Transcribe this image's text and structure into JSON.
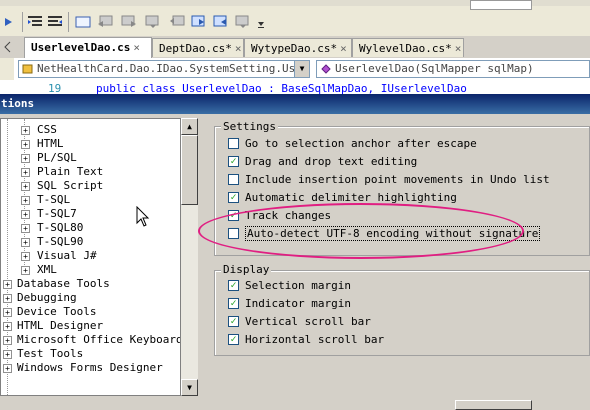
{
  "toolbar": {
    "icons": [
      "step-icon",
      "indent-icon",
      "outdent-icon",
      "comment-icon",
      "bookmark-prev-icon",
      "bookmark-next-icon",
      "bookmark-icon",
      "bookmark-toggle-icon",
      "bookmark-clear-icon",
      "overflow-icon"
    ]
  },
  "tabs": [
    {
      "label": "UserlevelDao.cs",
      "active": true,
      "close": "×"
    },
    {
      "label": "DeptDao.cs*",
      "active": false,
      "close": "×"
    },
    {
      "label": "WytypeDao.cs*",
      "active": false,
      "close": "×"
    },
    {
      "label": "WylevelDao.cs*",
      "active": false,
      "close": "×"
    }
  ],
  "navbar": {
    "type_combo": "NetHealthCard.Dao.IDao.SystemSetting.Userl",
    "member_combo": "UserlevelDao(SqlMapper sqlMap)"
  },
  "code": {
    "line_number": "19",
    "text": "public class UserlevelDao : BaseSqlMapDao, IUserlevelDao"
  },
  "dialog": {
    "title": "tions"
  },
  "tree": {
    "items": [
      {
        "label": "CSS",
        "level": 2,
        "expander": "+"
      },
      {
        "label": "HTML",
        "level": 2,
        "expander": "+"
      },
      {
        "label": "PL/SQL",
        "level": 2,
        "expander": "+"
      },
      {
        "label": "Plain Text",
        "level": 2,
        "expander": "+"
      },
      {
        "label": "SQL Script",
        "level": 2,
        "expander": "+"
      },
      {
        "label": "T-SQL",
        "level": 2,
        "expander": "+"
      },
      {
        "label": "T-SQL7",
        "level": 2,
        "expander": "+"
      },
      {
        "label": "T-SQL80",
        "level": 2,
        "expander": "+"
      },
      {
        "label": "T-SQL90",
        "level": 2,
        "expander": "+"
      },
      {
        "label": "Visual J#",
        "level": 2,
        "expander": "+"
      },
      {
        "label": "XML",
        "level": 2,
        "expander": "+"
      },
      {
        "label": "Database Tools",
        "level": 1,
        "expander": "+"
      },
      {
        "label": "Debugging",
        "level": 1,
        "expander": "+"
      },
      {
        "label": "Device Tools",
        "level": 1,
        "expander": "+"
      },
      {
        "label": "HTML Designer",
        "level": 1,
        "expander": "+"
      },
      {
        "label": "Microsoft Office Keyboard S",
        "level": 1,
        "expander": "+"
      },
      {
        "label": "Test Tools",
        "level": 1,
        "expander": "+"
      },
      {
        "label": "Windows Forms Designer",
        "level": 1,
        "expander": "+"
      }
    ]
  },
  "settings": {
    "title": "Settings",
    "options": [
      {
        "label": "Go to selection anchor after escape",
        "checked": false
      },
      {
        "label": "Drag and drop text editing",
        "checked": true
      },
      {
        "label": "Include insertion point movements in Undo list",
        "checked": false
      },
      {
        "label": "Automatic delimiter highlighting",
        "checked": true
      },
      {
        "label": "Track changes",
        "checked": true
      },
      {
        "label": "Auto-detect UTF-8 encoding without signature",
        "checked": false,
        "focused": true
      }
    ]
  },
  "display": {
    "title": "Display",
    "options": [
      {
        "label": "Selection margin",
        "checked": true
      },
      {
        "label": "Indicator margin",
        "checked": true
      },
      {
        "label": "Vertical scroll bar",
        "checked": true
      },
      {
        "label": "Horizontal scroll bar",
        "checked": true
      }
    ]
  },
  "colors": {
    "highlight": "#e01e82",
    "title_bar": "#0a246a",
    "check": "#21a121"
  }
}
